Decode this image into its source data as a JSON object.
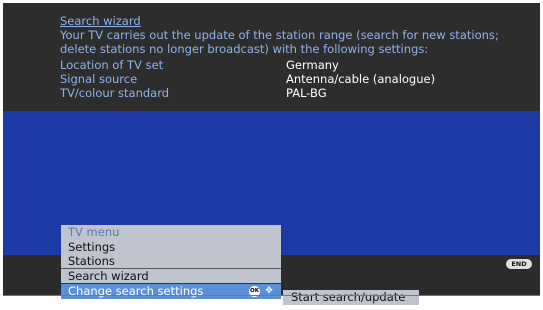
{
  "wizard": {
    "title": "Search wizard",
    "description": "Your TV carries out the update of the station range (search for new stations; delete stations no longer broadcast) with the following settings:",
    "settings": [
      {
        "label": "Location of TV set",
        "value": "Germany"
      },
      {
        "label": "Signal source",
        "value": "Antenna/cable (analogue)"
      },
      {
        "label": "TV/colour standard",
        "value": "PAL-BG"
      }
    ]
  },
  "menu": {
    "header": "TV menu",
    "items": [
      "Settings",
      "Stations",
      "Search wizard"
    ],
    "selected": "Change search settings"
  },
  "submenu": {
    "label": "Start search/update"
  },
  "keys": {
    "end": "END",
    "ok": "OK"
  },
  "colors": {
    "background": "#2b2b2b",
    "blue_area": "#1e3aa6",
    "text_blue": "#8fb3ee",
    "menu_bg": "#bfc4cf",
    "selected_bg": "#5b8fd6"
  }
}
